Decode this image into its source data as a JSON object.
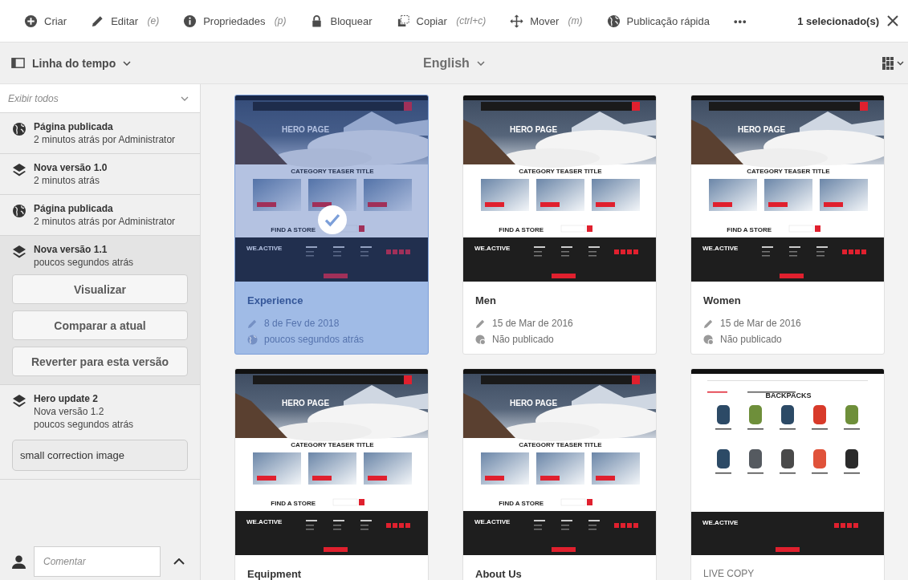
{
  "toolbar": {
    "actions": [
      {
        "kind": "create",
        "label": "Criar"
      },
      {
        "kind": "edit",
        "label": "Editar",
        "shortcut": "(e)"
      },
      {
        "kind": "info",
        "label": "Propriedades",
        "shortcut": "(p)"
      },
      {
        "kind": "lock",
        "label": "Bloquear"
      },
      {
        "kind": "copy",
        "label": "Copiar",
        "shortcut": "(ctrl+c)"
      },
      {
        "kind": "move",
        "label": "Mover",
        "shortcut": "(m)"
      },
      {
        "kind": "publish",
        "label": "Publicação rápida"
      },
      {
        "kind": "more",
        "label": "•••"
      }
    ],
    "selection_count": "1 selecionado(s)"
  },
  "header": {
    "rail_selector": "Linha do tempo",
    "language": "English"
  },
  "timeline": {
    "filter": "Exibir todos",
    "entries": [
      {
        "kind": "publish",
        "title": "Página publicada",
        "details": [
          "2 minutos atrás por Administrator"
        ],
        "expanded": false
      },
      {
        "kind": "version",
        "title": "Nova versão 1.0",
        "details": [
          "2 minutos atrás"
        ],
        "expanded": false
      },
      {
        "kind": "publish",
        "title": "Página publicada",
        "details": [
          "2 minutos atrás por Administrator"
        ],
        "expanded": false
      },
      {
        "kind": "version",
        "title": "Nova versão 1.1",
        "details": [
          "poucos segundos atrás"
        ],
        "expanded": true,
        "actions": [
          "Visualizar",
          "Comparar a atual",
          "Reverter para esta versão"
        ]
      },
      {
        "kind": "version",
        "title": "Hero update 2",
        "details": [
          "Nova versão 1.2",
          "poucos segundos atrás"
        ],
        "expanded": false,
        "comment": "small correction image"
      }
    ],
    "comment_placeholder": "Comentar"
  },
  "cards": [
    {
      "kind": "page",
      "title": "Experience",
      "selected": true,
      "thumbnail": {
        "kind": "hero",
        "heading": "HERO PAGE",
        "teaser": "CATEGORY TEASER TITLE",
        "store": "FIND A STORE",
        "brand": "WE.ACTIVE"
      },
      "modified": "8 de Fev de 2018",
      "published": true,
      "status": "poucos segundos atrás"
    },
    {
      "kind": "page",
      "title": "Men",
      "selected": false,
      "thumbnail": {
        "kind": "hero",
        "heading": "HERO PAGE",
        "teaser": "CATEGORY TEASER TITLE",
        "store": "FIND A STORE",
        "brand": "WE.ACTIVE"
      },
      "modified": "15 de Mar de 2016",
      "published": false,
      "status": "Não publicado"
    },
    {
      "kind": "page",
      "title": "Women",
      "selected": false,
      "thumbnail": {
        "kind": "hero",
        "heading": "HERO PAGE",
        "teaser": "CATEGORY TEASER TITLE",
        "store": "FIND A STORE",
        "brand": "WE.ACTIVE"
      },
      "modified": "15 de Mar de 2016",
      "published": false,
      "status": "Não publicado"
    },
    {
      "kind": "page",
      "title": "Equipment",
      "selected": false,
      "thumbnail": {
        "kind": "hero",
        "heading": "HERO PAGE",
        "teaser": "CATEGORY TEASER TITLE",
        "store": "FIND A STORE",
        "brand": "WE.ACTIVE"
      }
    },
    {
      "kind": "page",
      "title": "About Us",
      "selected": false,
      "thumbnail": {
        "kind": "hero",
        "heading": "HERO PAGE",
        "teaser": "CATEGORY TEASER TITLE",
        "store": "FIND A STORE",
        "brand": "WE.ACTIVE"
      }
    },
    {
      "kind": "live_copy",
      "title": "LIVE COPY",
      "selected": false,
      "thumbnail": {
        "kind": "catalog",
        "heading": "BACKPACKS",
        "brand": "WE.ACTIVE"
      }
    }
  ]
}
